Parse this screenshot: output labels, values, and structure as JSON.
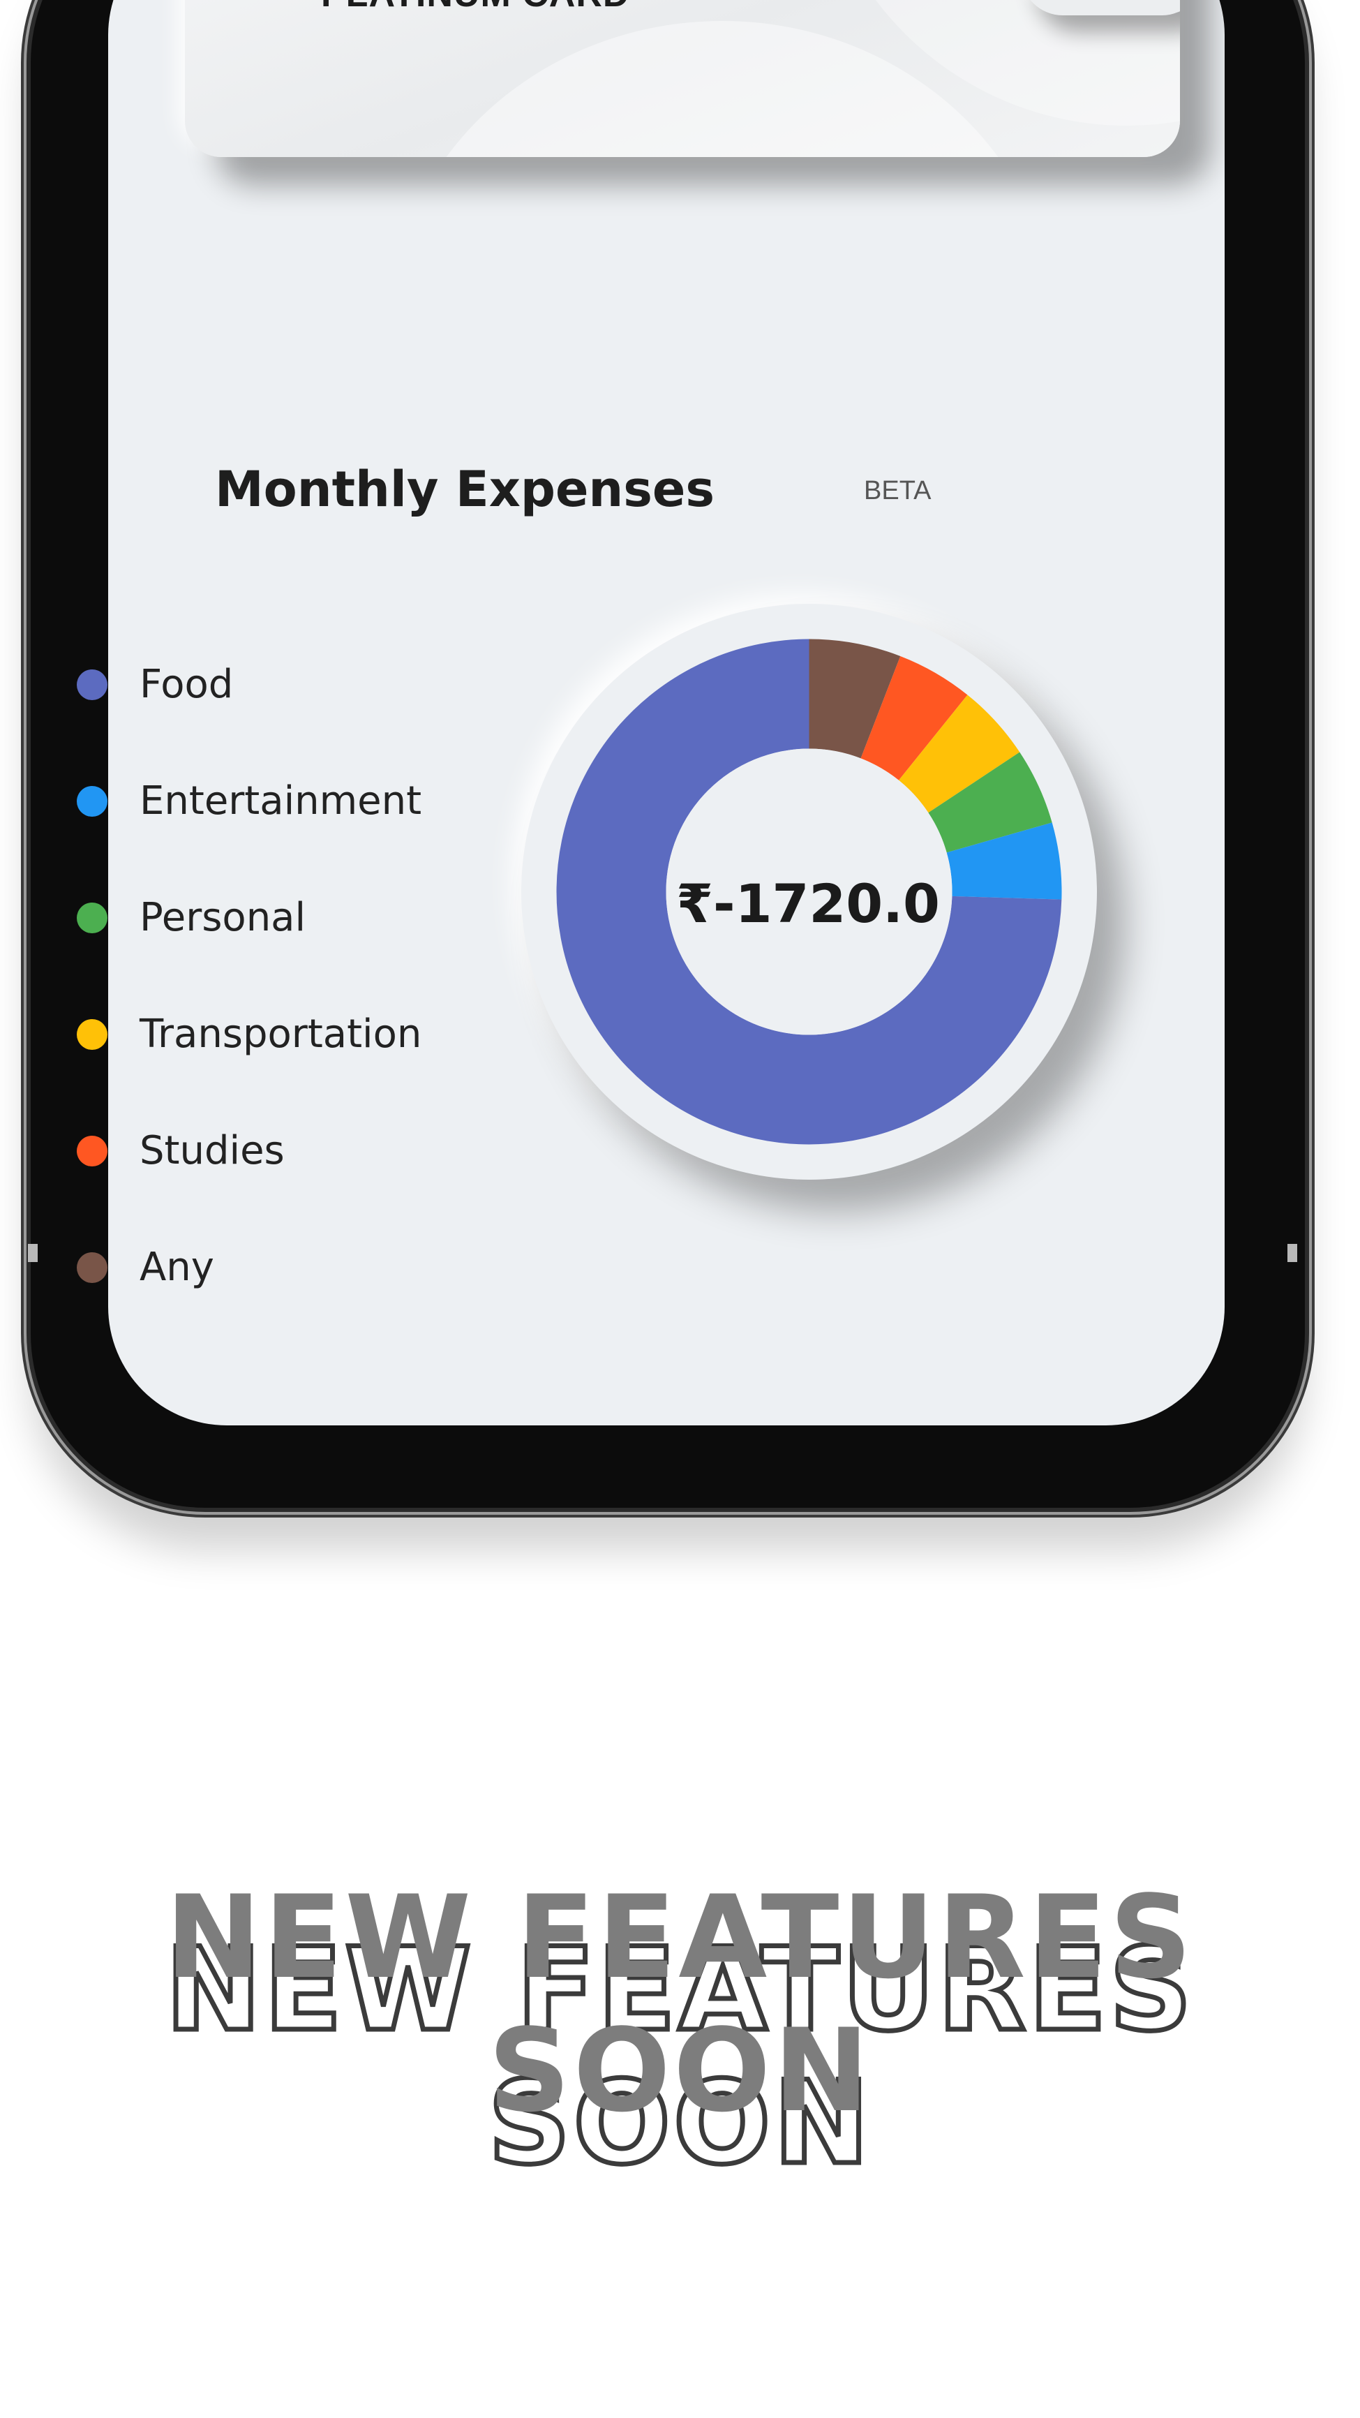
{
  "card": {
    "label": "PLATINUM CARD"
  },
  "expenses": {
    "title": "Monthly Expenses",
    "badge": "BETA",
    "total": "₹-1720.0"
  },
  "legend": [
    {
      "label": "Food",
      "color": "#5c6bc0"
    },
    {
      "label": "Entertainment",
      "color": "#2196f3"
    },
    {
      "label": "Personal",
      "color": "#4caf50"
    },
    {
      "label": "Transportation",
      "color": "#ffc107"
    },
    {
      "label": "Studies",
      "color": "#ff5722"
    },
    {
      "label": "Any",
      "color": "#795548"
    }
  ],
  "chart_data": {
    "type": "pie",
    "categories": [
      "Food",
      "Entertainment",
      "Personal",
      "Transportation",
      "Studies",
      "Any"
    ],
    "values": [
      76,
      5,
      5,
      5,
      5,
      6
    ],
    "unit": "percent of total (estimated)",
    "colors": [
      "#5c6bc0",
      "#2196f3",
      "#4caf50",
      "#ffc107",
      "#ff5722",
      "#795548"
    ]
  },
  "promo": {
    "text": "NEW FEATURES SOON"
  }
}
